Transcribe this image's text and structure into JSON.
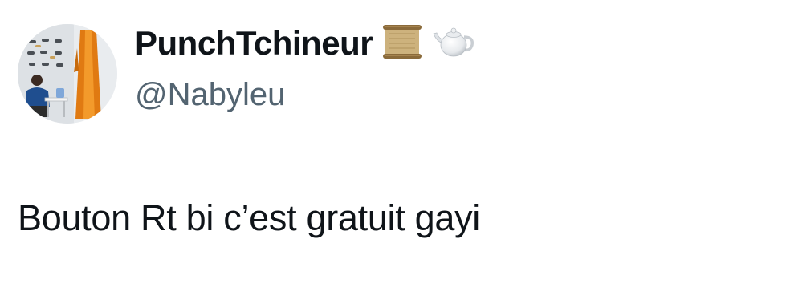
{
  "author": {
    "display_name": "PunchTchineur",
    "handle": "@Nabyleu",
    "name_emojis": [
      "scroll-icon",
      "teapot-icon"
    ]
  },
  "tweet": {
    "text": "Bouton Rt bi c’est gratuit gayi"
  }
}
